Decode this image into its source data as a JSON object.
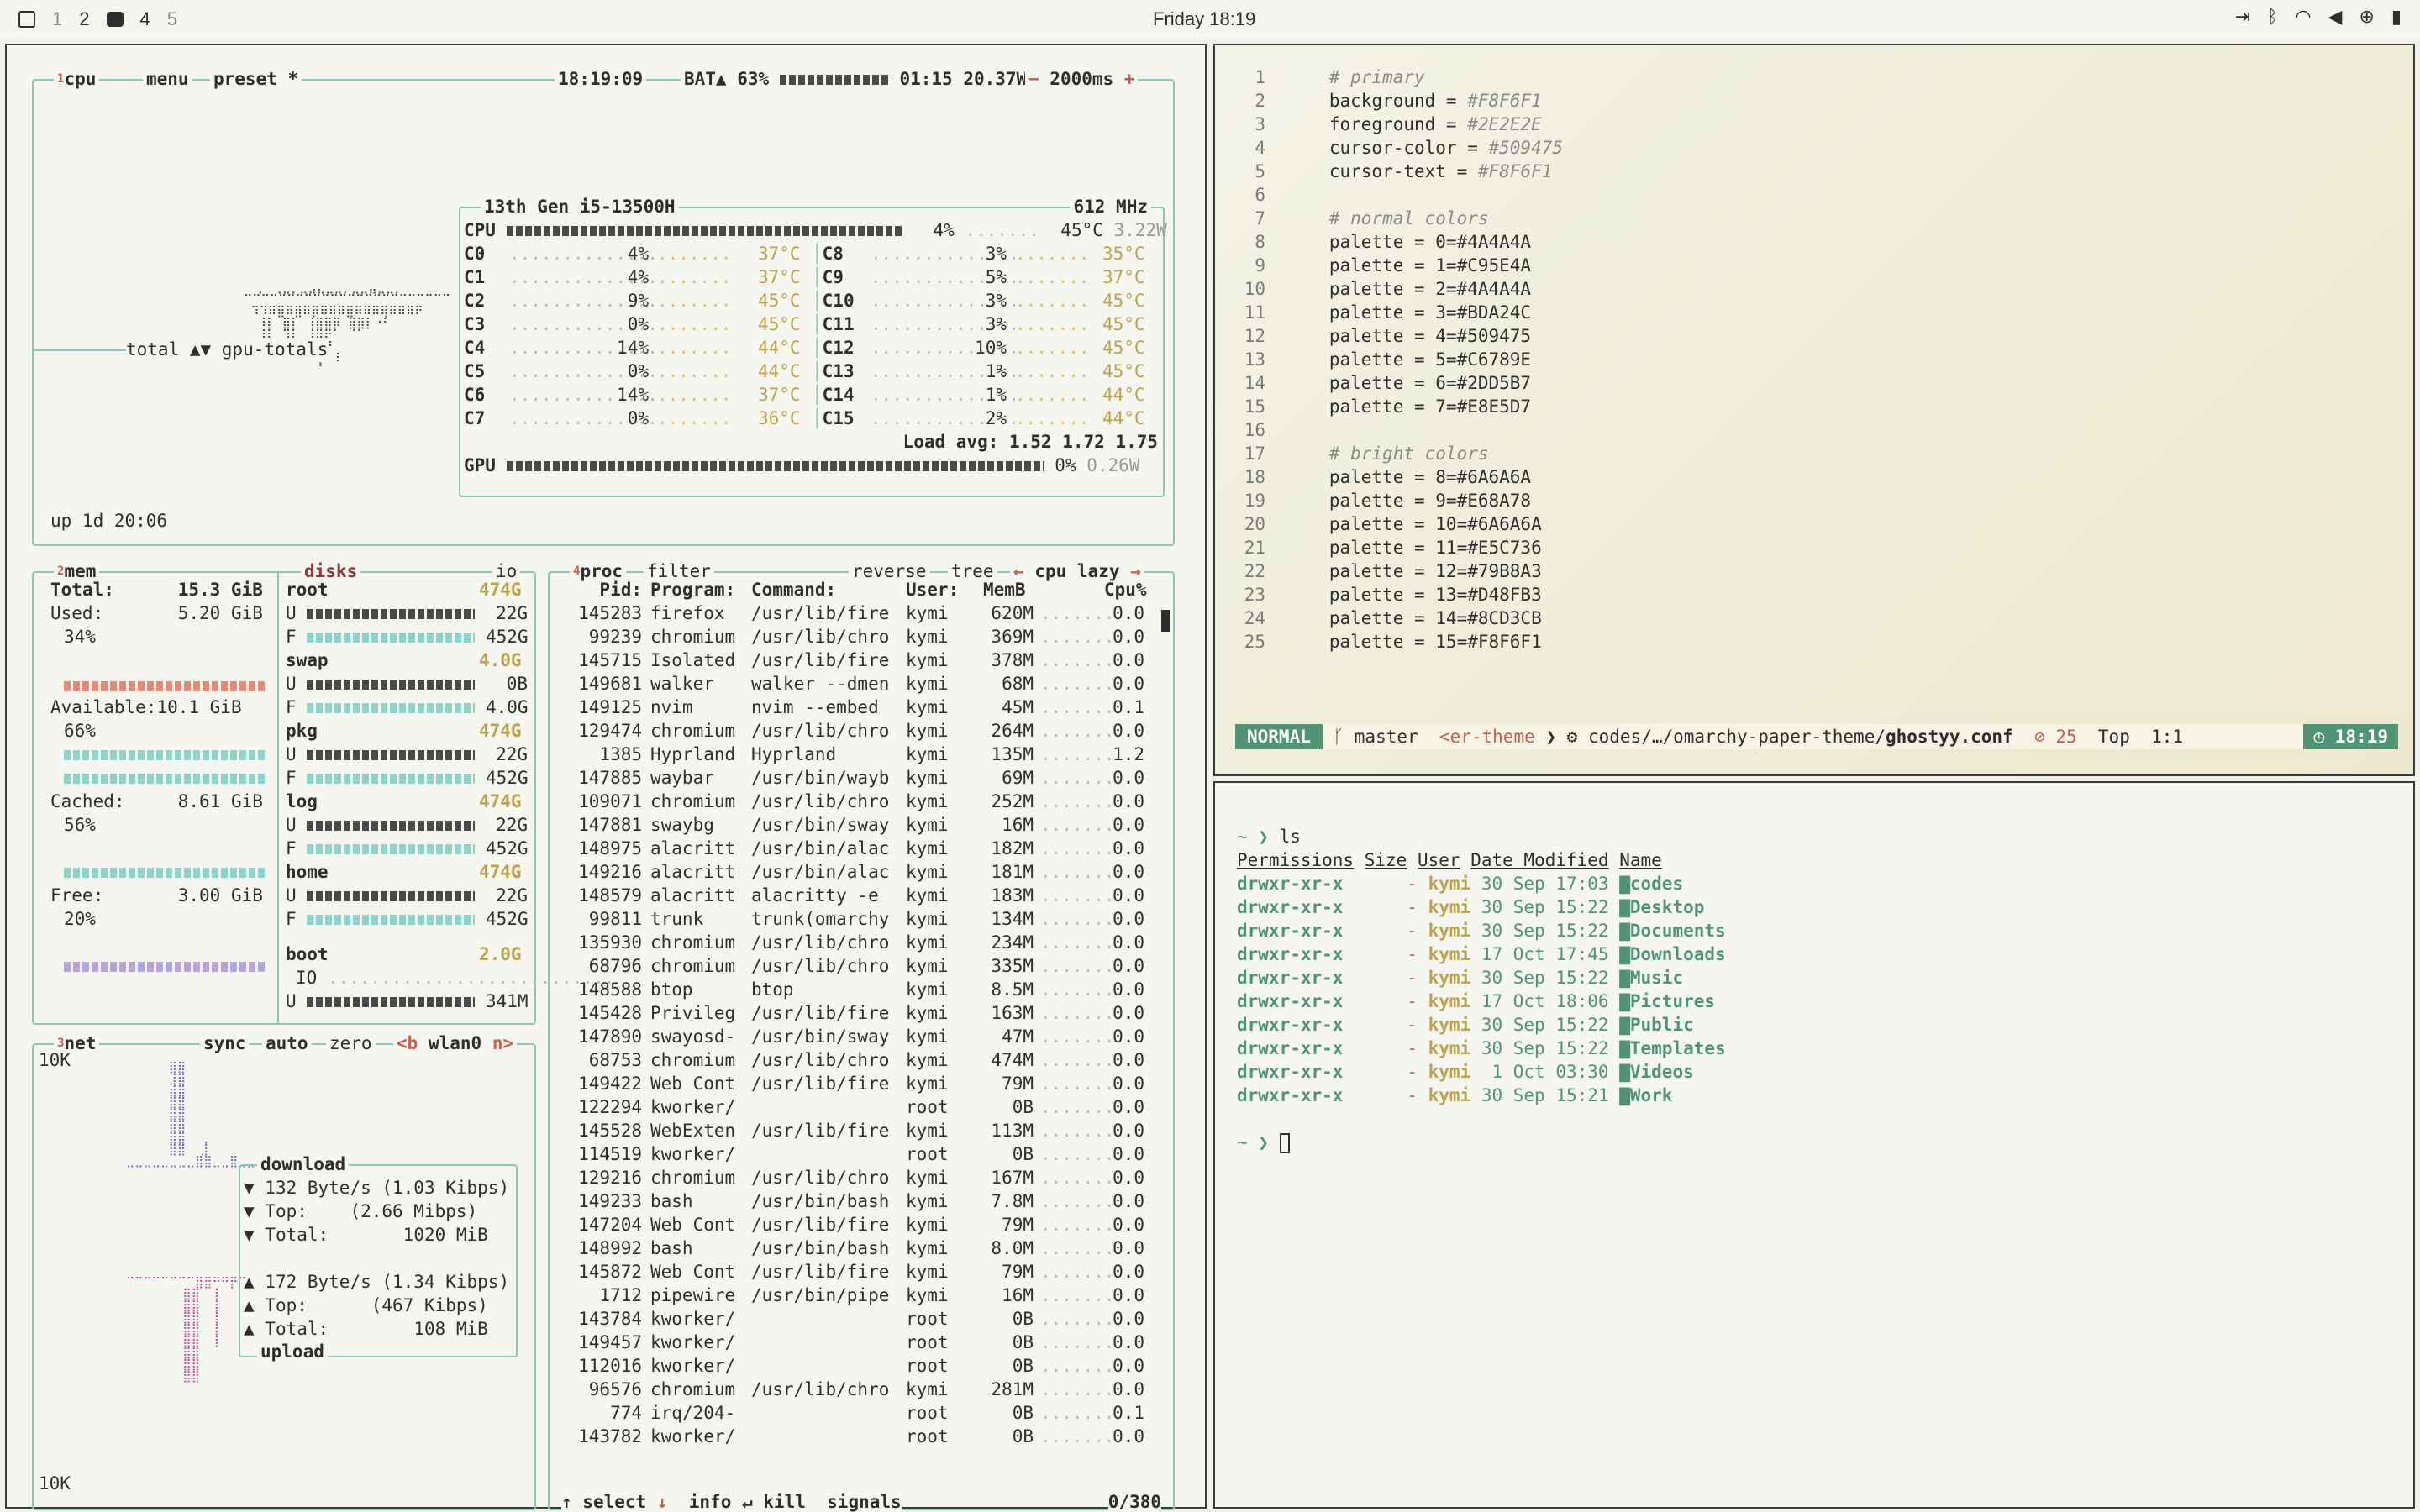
{
  "topbar": {
    "workspaces": [
      "1",
      "2",
      "3",
      "4",
      "5"
    ],
    "active_index": 2,
    "clock": "Friday 18:19",
    "tray": [
      "logout-icon",
      "bluetooth-icon",
      "wifi-icon",
      "volume-icon",
      "globe-icon",
      "battery-icon"
    ]
  },
  "btop": {
    "cpu_title": "cpu",
    "menu": "menu",
    "preset": "preset *",
    "clock": "18:19:09",
    "battery": "BAT▲ 63%",
    "battery_pct": 63,
    "bat_time": "01:15 20.37W",
    "refresh": "2000ms",
    "graph_label": "total ▲▼ gpu-totals",
    "uptime": "up 1d 20:06",
    "cpu_model": "13th Gen i5-13500H",
    "cpu_freq": "612 MHz",
    "cpu_total": {
      "label": "CPU",
      "pct": "4%",
      "temp": "45°C",
      "power": "3.22W"
    },
    "cores_left": [
      [
        "C0",
        "4%",
        "37°C"
      ],
      [
        "C1",
        "4%",
        "37°C"
      ],
      [
        "C2",
        "9%",
        "45°C"
      ],
      [
        "C3",
        "0%",
        "45°C"
      ],
      [
        "C4",
        "14%",
        "44°C"
      ],
      [
        "C5",
        "0%",
        "44°C"
      ],
      [
        "C6",
        "14%",
        "37°C"
      ],
      [
        "C7",
        "0%",
        "36°C"
      ]
    ],
    "cores_right": [
      [
        "C8",
        "3%",
        "35°C"
      ],
      [
        "C9",
        "5%",
        "37°C"
      ],
      [
        "C10",
        "3%",
        "45°C"
      ],
      [
        "C11",
        "3%",
        "45°C"
      ],
      [
        "C12",
        "10%",
        "45°C"
      ],
      [
        "C13",
        "1%",
        "45°C"
      ],
      [
        "C14",
        "1%",
        "44°C"
      ],
      [
        "C15",
        "2%",
        "44°C"
      ]
    ],
    "load_avg": "Load avg: 1.52 1.72 1.75",
    "gpu": {
      "label": "GPU",
      "pct": "0%",
      "power": "0.26W"
    },
    "mem": {
      "title": "mem",
      "total_label": "Total:",
      "total": "15.3 GiB",
      "used_label": "Used:",
      "used": "5.20 GiB",
      "used_pct": "34%",
      "avail_label": "Available:",
      "avail": "10.1 GiB",
      "avail_pct": "66%",
      "cached_label": "Cached:",
      "cached": "8.61 GiB",
      "cached_pct": "56%",
      "free_label": "Free:",
      "free": "3.00 GiB",
      "free_pct": "20%"
    },
    "disks": {
      "title": "disks",
      "io": "io",
      "items": [
        {
          "name": "root",
          "size": "474G",
          "u": "22G",
          "f": "452G"
        },
        {
          "name": "swap",
          "size": "4.0G",
          "u": "0B",
          "f": "4.0G"
        },
        {
          "name": "pkg",
          "size": "474G",
          "u": "22G",
          "f": "452G"
        },
        {
          "name": "log",
          "size": "474G",
          "u": "22G",
          "f": "452G"
        },
        {
          "name": "home",
          "size": "474G",
          "u": "22G",
          "f": "452G"
        }
      ],
      "boot": {
        "name": "boot",
        "size": "2.0G",
        "io": "IO",
        "u": "341M"
      }
    },
    "net": {
      "title": "net",
      "sync": "sync",
      "auto": "auto",
      "zero": "zero",
      "b": "<b",
      "iface": "wlan0",
      "n": "n>",
      "scale_top": "10K",
      "scale_bottom": "10K",
      "download": {
        "title": "download",
        "rate": "132 Byte/s (1.03 Kibps)",
        "top_label": "Top:",
        "top": "(2.66 Mibps)",
        "total_label": "Total:",
        "total": "1020 MiB"
      },
      "upload": {
        "title": "upload",
        "rate": "172 Byte/s (1.34 Kibps)",
        "top_label": "Top:",
        "top": "(467 Kibps)",
        "total_label": "Total:",
        "total": "108 MiB"
      }
    },
    "proc": {
      "title": "proc",
      "filter": "filter",
      "reverse": "reverse",
      "tree": "tree",
      "sort": "cpu lazy",
      "headers": [
        "Pid:",
        "Program:",
        "Command:",
        "User:",
        "MemB",
        "Cpu%"
      ],
      "rows": [
        [
          "145283",
          "firefox",
          "/usr/lib/fire",
          "kymi",
          "620M",
          "0.0"
        ],
        [
          "99239",
          "chromium",
          "/usr/lib/chro",
          "kymi",
          "369M",
          "0.0"
        ],
        [
          "145715",
          "Isolated",
          "/usr/lib/fire",
          "kymi",
          "378M",
          "0.0"
        ],
        [
          "149681",
          "walker",
          "walker --dmen",
          "kymi",
          "68M",
          "0.0"
        ],
        [
          "149125",
          "nvim",
          "nvim --embed",
          "kymi",
          "45M",
          "0.1"
        ],
        [
          "129474",
          "chromium",
          "/usr/lib/chro",
          "kymi",
          "264M",
          "0.0"
        ],
        [
          "1385",
          "Hyprland",
          "Hyprland",
          "kymi",
          "135M",
          "1.2"
        ],
        [
          "147885",
          "waybar",
          "/usr/bin/wayb",
          "kymi",
          "69M",
          "0.0"
        ],
        [
          "109071",
          "chromium",
          "/usr/lib/chro",
          "kymi",
          "252M",
          "0.0"
        ],
        [
          "147881",
          "swaybg",
          "/usr/bin/sway",
          "kymi",
          "16M",
          "0.0"
        ],
        [
          "148975",
          "alacritt",
          "/usr/bin/alac",
          "kymi",
          "182M",
          "0.0"
        ],
        [
          "149216",
          "alacritt",
          "/usr/bin/alac",
          "kymi",
          "181M",
          "0.0"
        ],
        [
          "148579",
          "alacritt",
          "alacritty -e",
          "kymi",
          "183M",
          "0.0"
        ],
        [
          "99811",
          "trunk",
          "trunk(omarchy",
          "kymi",
          "134M",
          "0.0"
        ],
        [
          "135930",
          "chromium",
          "/usr/lib/chro",
          "kymi",
          "234M",
          "0.0"
        ],
        [
          "68796",
          "chromium",
          "/usr/lib/chro",
          "kymi",
          "335M",
          "0.0"
        ],
        [
          "148588",
          "btop",
          "btop",
          "kymi",
          "8.5M",
          "0.0"
        ],
        [
          "145428",
          "Privileg",
          "/usr/lib/fire",
          "kymi",
          "163M",
          "0.0"
        ],
        [
          "147890",
          "swayosd-",
          "/usr/bin/sway",
          "kymi",
          "47M",
          "0.0"
        ],
        [
          "68753",
          "chromium",
          "/usr/lib/chro",
          "kymi",
          "474M",
          "0.0"
        ],
        [
          "149422",
          "Web Cont",
          "/usr/lib/fire",
          "kymi",
          "79M",
          "0.0"
        ],
        [
          "122294",
          "kworker/",
          "",
          "root",
          "0B",
          "0.0"
        ],
        [
          "145528",
          "WebExten",
          "/usr/lib/fire",
          "kymi",
          "113M",
          "0.0"
        ],
        [
          "114519",
          "kworker/",
          "",
          "root",
          "0B",
          "0.0"
        ],
        [
          "129216",
          "chromium",
          "/usr/lib/chro",
          "kymi",
          "167M",
          "0.0"
        ],
        [
          "149233",
          "bash",
          "/usr/bin/bash",
          "kymi",
          "7.8M",
          "0.0"
        ],
        [
          "147204",
          "Web Cont",
          "/usr/lib/fire",
          "kymi",
          "79M",
          "0.0"
        ],
        [
          "148992",
          "bash",
          "/usr/bin/bash",
          "kymi",
          "8.0M",
          "0.0"
        ],
        [
          "145872",
          "Web Cont",
          "/usr/lib/fire",
          "kymi",
          "79M",
          "0.0"
        ],
        [
          "1712",
          "pipewire",
          "/usr/bin/pipe",
          "kymi",
          "16M",
          "0.0"
        ],
        [
          "143784",
          "kworker/",
          "",
          "root",
          "0B",
          "0.0"
        ],
        [
          "149457",
          "kworker/",
          "",
          "root",
          "0B",
          "0.0"
        ],
        [
          "112016",
          "kworker/",
          "",
          "root",
          "0B",
          "0.0"
        ],
        [
          "96576",
          "chromium",
          "/usr/lib/chro",
          "kymi",
          "281M",
          "0.0"
        ],
        [
          "774",
          "irq/204-",
          "",
          "root",
          "0B",
          "0.1"
        ],
        [
          "143782",
          "kworker/",
          "",
          "root",
          "0B",
          "0.0"
        ]
      ],
      "footer": {
        "select": "select",
        "info": "info",
        "kill": "kill",
        "signals": "signals",
        "count": "0/380"
      }
    }
  },
  "editor": {
    "lines": [
      {
        "n": "1",
        "t": "# primary",
        "c": true
      },
      {
        "n": "2",
        "k": "background = ",
        "v": "#F8F6F1"
      },
      {
        "n": "3",
        "k": "foreground = ",
        "v": "#2E2E2E"
      },
      {
        "n": "4",
        "k": "cursor-color = ",
        "v": "#509475"
      },
      {
        "n": "5",
        "k": "cursor-text = ",
        "v": "#F8F6F1"
      },
      {
        "n": "6",
        "t": ""
      },
      {
        "n": "7",
        "t": "# normal colors",
        "c": true
      },
      {
        "n": "8",
        "t": "palette = 0=#4A4A4A"
      },
      {
        "n": "9",
        "t": "palette = 1=#C95E4A"
      },
      {
        "n": "10",
        "t": "palette = 2=#4A4A4A"
      },
      {
        "n": "11",
        "t": "palette = 3=#BDA24C"
      },
      {
        "n": "12",
        "t": "palette = 4=#509475"
      },
      {
        "n": "13",
        "t": "palette = 5=#C6789E"
      },
      {
        "n": "14",
        "t": "palette = 6=#2DD5B7"
      },
      {
        "n": "15",
        "t": "palette = 7=#E8E5D7"
      },
      {
        "n": "16",
        "t": ""
      },
      {
        "n": "17",
        "t": "# bright colors",
        "c": true
      },
      {
        "n": "18",
        "t": "palette = 8=#6A6A6A"
      },
      {
        "n": "19",
        "t": "palette = 9=#E68A78"
      },
      {
        "n": "20",
        "t": "palette = 10=#6A6A6A"
      },
      {
        "n": "21",
        "t": "palette = 11=#E5C736"
      },
      {
        "n": "22",
        "t": "palette = 12=#79B8A3"
      },
      {
        "n": "23",
        "t": "palette = 13=#D48FB3"
      },
      {
        "n": "24",
        "t": "palette = 14=#8CD3CB"
      },
      {
        "n": "25",
        "t": "palette = 15=#F8F6F1"
      }
    ],
    "status": {
      "mode": "NORMAL",
      "branch": "master",
      "theme": "<er-theme",
      "path": "codes/…/omarchy-paper-theme/",
      "file": "ghostyy.conf",
      "count": "25",
      "pos": "Top",
      "cursor": "1:1",
      "time": "18:19"
    }
  },
  "terminal": {
    "prompt": "~ ❯",
    "cmd": "ls",
    "headers": [
      "Permissions",
      "Size",
      "User",
      "Date Modified",
      "Name"
    ],
    "rows": [
      [
        "drwxr-xr-x",
        "-",
        "kymi",
        "30 Sep 17:03",
        "codes"
      ],
      [
        "drwxr-xr-x",
        "-",
        "kymi",
        "30 Sep 15:22",
        "Desktop"
      ],
      [
        "drwxr-xr-x",
        "-",
        "kymi",
        "30 Sep 15:22",
        "Documents"
      ],
      [
        "drwxr-xr-x",
        "-",
        "kymi",
        "17 Oct 17:45",
        "Downloads"
      ],
      [
        "drwxr-xr-x",
        "-",
        "kymi",
        "30 Sep 15:22",
        "Music"
      ],
      [
        "drwxr-xr-x",
        "-",
        "kymi",
        "17 Oct 18:06",
        "Pictures"
      ],
      [
        "drwxr-xr-x",
        "-",
        "kymi",
        "30 Sep 15:22",
        "Public"
      ],
      [
        "drwxr-xr-x",
        "-",
        "kymi",
        "30 Sep 15:22",
        "Templates"
      ],
      [
        "drwxr-xr-x",
        "-",
        "kymi",
        " 1 Oct 03:30",
        "Videos"
      ],
      [
        "drwxr-xr-x",
        "-",
        "kymi",
        "30 Sep 15:21",
        "Work"
      ]
    ]
  }
}
